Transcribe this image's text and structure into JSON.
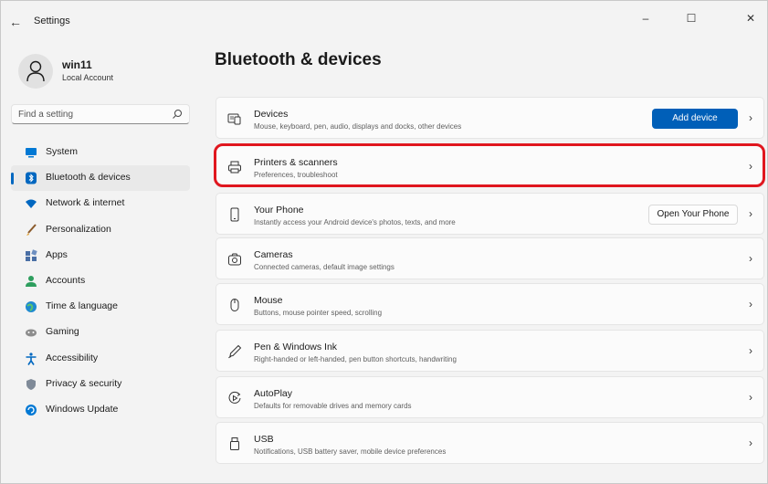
{
  "window": {
    "title": "Settings",
    "back_glyph": "←",
    "minimize_glyph": "–",
    "maximize_glyph": "☐",
    "close_glyph": "✕"
  },
  "profile": {
    "name": "win11",
    "account_type": "Local Account"
  },
  "search": {
    "placeholder": "Find a setting"
  },
  "sidebar": {
    "items": [
      {
        "label": "System",
        "icon": "monitor-icon",
        "active": false
      },
      {
        "label": "Bluetooth & devices",
        "icon": "bluetooth-icon",
        "active": true
      },
      {
        "label": "Network & internet",
        "icon": "wifi-icon",
        "active": false
      },
      {
        "label": "Personalization",
        "icon": "brush-icon",
        "active": false
      },
      {
        "label": "Apps",
        "icon": "apps-icon",
        "active": false
      },
      {
        "label": "Accounts",
        "icon": "person-icon",
        "active": false
      },
      {
        "label": "Time & language",
        "icon": "globe-clock-icon",
        "active": false
      },
      {
        "label": "Gaming",
        "icon": "controller-icon",
        "active": false
      },
      {
        "label": "Accessibility",
        "icon": "accessibility-icon",
        "active": false
      },
      {
        "label": "Privacy & security",
        "icon": "shield-icon",
        "active": false
      },
      {
        "label": "Windows Update",
        "icon": "update-icon",
        "active": false
      }
    ]
  },
  "main": {
    "title": "Bluetooth & devices",
    "cards": [
      {
        "title": "Devices",
        "subtitle": "Mouse, keyboard, pen, audio, displays and docks, other devices",
        "icon": "devices-icon",
        "button": "Add device"
      },
      {
        "title": "Printers & scanners",
        "subtitle": "Preferences, troubleshoot",
        "icon": "printer-icon"
      },
      {
        "title": "Your Phone",
        "subtitle": "Instantly access your Android device's photos, texts, and more",
        "icon": "phone-icon",
        "button": "Open Your Phone"
      },
      {
        "title": "Cameras",
        "subtitle": "Connected cameras, default image settings",
        "icon": "camera-icon"
      },
      {
        "title": "Mouse",
        "subtitle": "Buttons, mouse pointer speed, scrolling",
        "icon": "mouse-icon"
      },
      {
        "title": "Pen & Windows Ink",
        "subtitle": "Right-handed or left-handed, pen button shortcuts, handwriting",
        "icon": "pen-icon"
      },
      {
        "title": "AutoPlay",
        "subtitle": "Defaults for removable drives and memory cards",
        "icon": "autoplay-icon"
      },
      {
        "title": "USB",
        "subtitle": "Notifications, USB battery saver, mobile device preferences",
        "icon": "usb-icon"
      }
    ],
    "chevron": "›"
  },
  "colors": {
    "accent": "#005fb8",
    "highlight": "#e0161e",
    "background": "#f3f3f3"
  }
}
